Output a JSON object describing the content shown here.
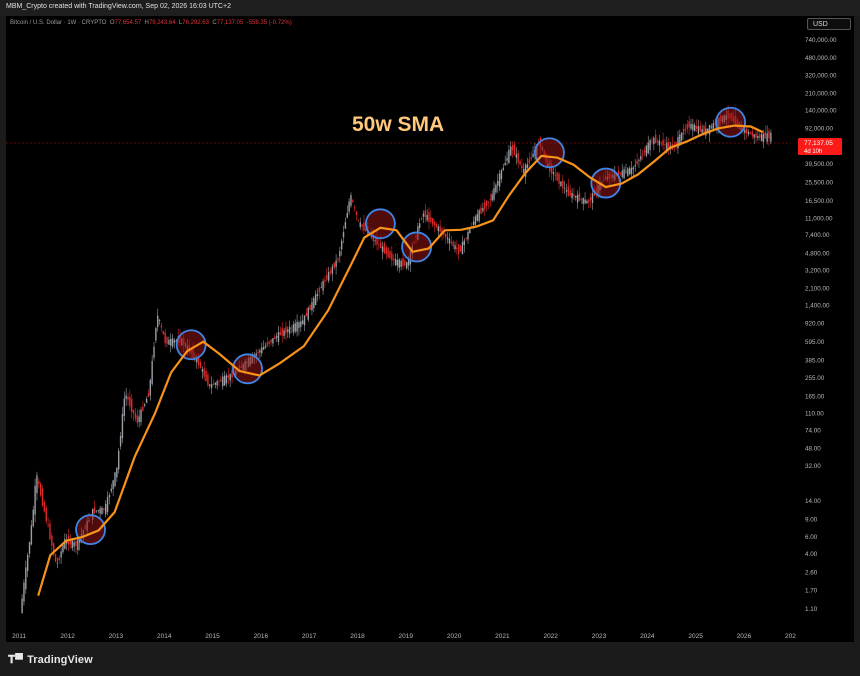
{
  "header": {
    "credit": "MBM_Crypto created with TradingView.com, Sep 02, 2026 16:03 UTC+2",
    "symbol_line": "Bitcoin / U.S. Dollar · 1W · CRYPTO",
    "ohlc": {
      "o_label": "O",
      "o": "77,654.57",
      "h_label": "H",
      "h": "79,243.64",
      "l_label": "L",
      "l": "76,292.63",
      "c_label": "C",
      "c": "77,137.05",
      "change": "-558.35 (-0.72%)"
    }
  },
  "currency_button": "USD",
  "annotation": "50w SMA",
  "price_tag": {
    "price": "77,137.05",
    "countdown": "4d 10h"
  },
  "colors": {
    "sma": "#f7931a",
    "annotation": "#ffc87a",
    "circle": "#3f86e8",
    "up": "#9aa0a6",
    "down": "#e02a2a",
    "price_tag": "#ff1a1a"
  },
  "chart_data": {
    "type": "line",
    "scale": "log",
    "ylim": [
      0.7,
      1300000
    ],
    "xlim": [
      "2010-10",
      "2027-01"
    ],
    "y_ticks": [
      "740,000.00",
      "480,000.00",
      "320,000.00",
      "210,000.00",
      "140,000.00",
      "92,000.00",
      "39,500.00",
      "25,500.00",
      "16,500.00",
      "11,000.00",
      "7,400.00",
      "4,800.00",
      "3,200.00",
      "2,100.00",
      "1,400.00",
      "920.00",
      "595.00",
      "385.00",
      "255.00",
      "165.00",
      "110.00",
      "74.00",
      "48.00",
      "32.00",
      "14.00",
      "9.00",
      "6.00",
      "4.00",
      "2.60",
      "1.70",
      "1.10"
    ],
    "x_ticks": [
      "2011",
      "2012",
      "2013",
      "2014",
      "2015",
      "2016",
      "2017",
      "2018",
      "2019",
      "2020",
      "2021",
      "2022",
      "2023",
      "2024",
      "2025",
      "2026",
      "202"
    ],
    "series": [
      {
        "name": "50w SMA",
        "x": [
          "2011-06",
          "2011-09",
          "2012-01",
          "2012-05",
          "2012-09",
          "2013-01",
          "2013-06",
          "2013-11",
          "2014-03",
          "2014-07",
          "2014-11",
          "2015-03",
          "2015-08",
          "2016-01",
          "2016-06",
          "2016-12",
          "2017-06",
          "2017-12",
          "2018-03",
          "2018-07",
          "2018-11",
          "2019-03",
          "2019-07",
          "2019-11",
          "2020-03",
          "2020-07",
          "2020-11",
          "2021-03",
          "2021-07",
          "2021-11",
          "2022-03",
          "2022-07",
          "2022-11",
          "2023-03",
          "2023-07",
          "2023-11",
          "2024-03",
          "2024-07",
          "2024-11",
          "2025-03",
          "2025-07",
          "2025-11",
          "2026-03",
          "2026-06"
        ],
        "values": [
          1.5,
          3.9,
          5.5,
          6.0,
          7.0,
          10.8,
          40,
          110,
          290,
          480,
          600,
          450,
          300,
          270,
          360,
          540,
          1250,
          3900,
          7000,
          8800,
          8300,
          5000,
          5400,
          8300,
          8400,
          9100,
          10500,
          19000,
          32000,
          48000,
          46000,
          39000,
          29000,
          23000,
          25000,
          31000,
          42000,
          58000,
          67000,
          80000,
          92000,
          98000,
          96000,
          84000
        ]
      }
    ],
    "candles": [
      {
        "x": "2011-02",
        "v": 1.0
      },
      {
        "x": "2011-05",
        "v": 9.0
      },
      {
        "x": "2011-06",
        "v": 26.0
      },
      {
        "x": "2011-08",
        "v": 11.0
      },
      {
        "x": "2011-11",
        "v": 3.0
      },
      {
        "x": "2012-01",
        "v": 5.5
      },
      {
        "x": "2012-04",
        "v": 5.0
      },
      {
        "x": "2012-08",
        "v": 11.0
      },
      {
        "x": "2012-11",
        "v": 11.5
      },
      {
        "x": "2013-02",
        "v": 30.0
      },
      {
        "x": "2013-04",
        "v": 180.0
      },
      {
        "x": "2013-07",
        "v": 90.0
      },
      {
        "x": "2013-10",
        "v": 180.0
      },
      {
        "x": "2013-12",
        "v": 1150.0
      },
      {
        "x": "2014-02",
        "v": 600.0
      },
      {
        "x": "2014-06",
        "v": 620.0
      },
      {
        "x": "2014-10",
        "v": 380.0
      },
      {
        "x": "2015-01",
        "v": 210.0
      },
      {
        "x": "2015-07",
        "v": 280.0
      },
      {
        "x": "2015-12",
        "v": 430.0
      },
      {
        "x": "2016-06",
        "v": 700.0
      },
      {
        "x": "2016-12",
        "v": 950.0
      },
      {
        "x": "2017-05",
        "v": 2300.0
      },
      {
        "x": "2017-09",
        "v": 4300.0
      },
      {
        "x": "2017-12",
        "v": 19000.0
      },
      {
        "x": "2018-02",
        "v": 10000.0
      },
      {
        "x": "2018-06",
        "v": 6500.0
      },
      {
        "x": "2018-11",
        "v": 4000.0
      },
      {
        "x": "2019-02",
        "v": 3700.0
      },
      {
        "x": "2019-06",
        "v": 12500.0
      },
      {
        "x": "2019-10",
        "v": 8500.0
      },
      {
        "x": "2020-03",
        "v": 5000.0
      },
      {
        "x": "2020-07",
        "v": 11000.0
      },
      {
        "x": "2020-11",
        "v": 18000.0
      },
      {
        "x": "2021-04",
        "v": 60000.0
      },
      {
        "x": "2021-07",
        "v": 33000.0
      },
      {
        "x": "2021-11",
        "v": 67000.0
      },
      {
        "x": "2022-01",
        "v": 38000.0
      },
      {
        "x": "2022-06",
        "v": 20000.0
      },
      {
        "x": "2022-11",
        "v": 16000.0
      },
      {
        "x": "2023-03",
        "v": 28000.0
      },
      {
        "x": "2023-10",
        "v": 35000.0
      },
      {
        "x": "2024-03",
        "v": 71000.0
      },
      {
        "x": "2024-08",
        "v": 58000.0
      },
      {
        "x": "2024-12",
        "v": 100000.0
      },
      {
        "x": "2025-04",
        "v": 85000.0
      },
      {
        "x": "2025-08",
        "v": 115000.0
      },
      {
        "x": "2025-10",
        "v": 124000.0
      },
      {
        "x": "2026-01",
        "v": 90000.0
      },
      {
        "x": "2026-05",
        "v": 75000.0
      },
      {
        "x": "2026-08",
        "v": 77137.05
      }
    ],
    "highlights": [
      "2012-07",
      "2014-08",
      "2015-10",
      "2018-07",
      "2019-04",
      "2022-01",
      "2023-03",
      "2025-10"
    ]
  },
  "footer": {
    "brand": "TradingView"
  }
}
